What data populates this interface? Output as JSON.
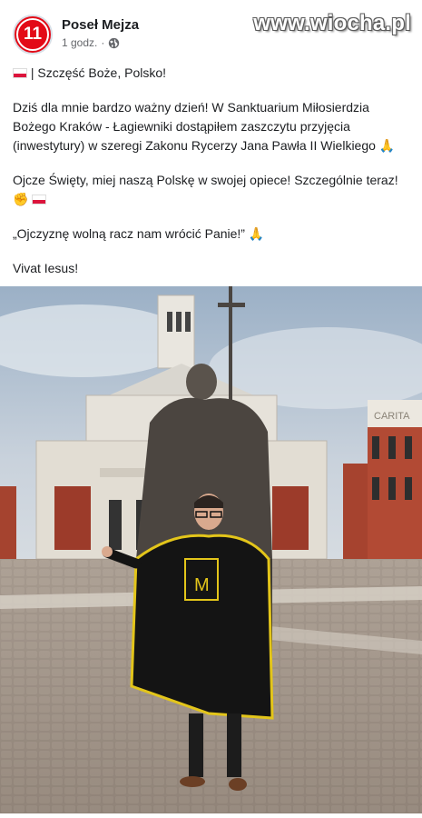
{
  "post": {
    "author": "Poseł Mejza",
    "avatar_text": "11",
    "time": "1 godz.",
    "separator": "·",
    "visibility_icon": "globe-icon"
  },
  "watermark": "www.wiocha.pl",
  "text": {
    "line1": "| Szczęść Boże, Polsko!",
    "para2": "Dziś dla mnie bardzo ważny dzień! W Sanktuarium Miłosierdzia Bożego Kraków - Łagiewniki dostąpiłem zaszczytu przyjęcia (inwestytury) w szeregi Zakonu Rycerzy Jana Pawła II Wielkiego",
    "para3": "Ojcze Święty, miej naszą Polskę w swojej opiece! Szczególnie teraz!",
    "para4": "„Ojczyznę wolną racz nam wrócić Panie!”",
    "para5": "Vivat Iesus!"
  },
  "emoji": {
    "pray": "🙏",
    "fist": "✊"
  },
  "photo": {
    "building_inscription": "CARITA"
  },
  "colors": {
    "avatar_red": "#e30a17",
    "text": "#1c1e21",
    "meta": "#65676b"
  }
}
